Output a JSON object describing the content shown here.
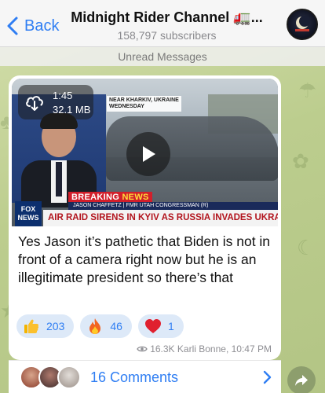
{
  "header": {
    "back_label": "Back",
    "title": "Midnight Rider Channel 🚛...",
    "subscribers": "158,797 subscribers"
  },
  "divider": {
    "unread_label": "Unread Messages"
  },
  "post": {
    "video": {
      "duration": "1:45",
      "size": "32.1 MB",
      "location_line1": "NEAR KHARKIV, UKRAINE",
      "location_line2": "WEDNESDAY",
      "breaking_a": "BREAKING",
      "breaking_b": "NEWS",
      "nameplate": "JASON CHAFFETZ | FMR UTAH CONGRESSMAN (R)",
      "headline": "AIR RAID SIRENS IN KYIV AS RUSSIA INVADES UKRAINE",
      "logo_line1": "FOX",
      "logo_line2": "NEWS"
    },
    "text": "Yes Jason it’s pathetic that Biden is not in front of a camera right now but he is an illegitimate president so there’s that",
    "reactions": [
      {
        "emoji": "thumbs-up-icon",
        "count": "203"
      },
      {
        "emoji": "fire-icon",
        "count": "46"
      },
      {
        "emoji": "heart-icon",
        "count": "1"
      }
    ],
    "meta": {
      "views": "16.3K",
      "author": "Karli Bonne",
      "time": "10:47 PM"
    }
  },
  "comments": {
    "label": "16 Comments"
  },
  "colors": {
    "accent": "#2f7ef3",
    "reaction_bg": "#dde9f8",
    "breaking_red": "#d21f2b"
  }
}
